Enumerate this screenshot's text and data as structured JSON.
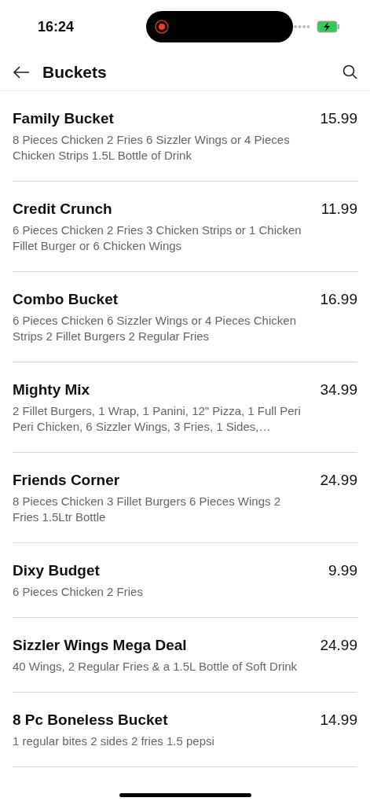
{
  "status_bar": {
    "time": "16:24",
    "recording": true,
    "charging": true
  },
  "header": {
    "title": "Buckets"
  },
  "items": [
    {
      "name": "Family Bucket",
      "price": "15.99",
      "description": "8 Pieces Chicken 2 Fries 6 Sizzler Wings or 4 Pieces Chicken Strips 1.5L Bottle of Drink"
    },
    {
      "name": "Credit Crunch",
      "price": "11.99",
      "description": "6 Pieces Chicken 2 Fries 3 Chicken Strips or 1 Chicken Fillet Burger or 6 Chicken Wings"
    },
    {
      "name": "Combo Bucket",
      "price": "16.99",
      "description": "6 Pieces Chicken 6 Sizzler Wings or 4 Pieces Chicken Strips 2 Fillet Burgers 2 Regular Fries"
    },
    {
      "name": "Mighty Mix",
      "price": "34.99",
      "description": "2 Fillet Burgers, 1 Wrap, 1 Panini, 12\" Pizza, 1 Full Peri Peri Chicken, 6 Sizzler Wings, 3 Fries, 1 Sides,…"
    },
    {
      "name": "Friends Corner",
      "price": "24.99",
      "description": "8 Pieces Chicken 3 Fillet Burgers 6 Pieces Wings 2 Fries 1.5Ltr Bottle"
    },
    {
      "name": "Dixy Budget",
      "price": "9.99",
      "description": "6 Pieces Chicken 2 Fries"
    },
    {
      "name": "Sizzler Wings Mega Deal",
      "price": "24.99",
      "description": "40 Wings, 2 Regular Fries & a 1.5L Bottle of Soft Drink"
    },
    {
      "name": "8 Pc Boneless Bucket",
      "price": "14.99",
      "description": "1 regular bites 2 sides 2 fries 1.5 pepsi"
    }
  ]
}
